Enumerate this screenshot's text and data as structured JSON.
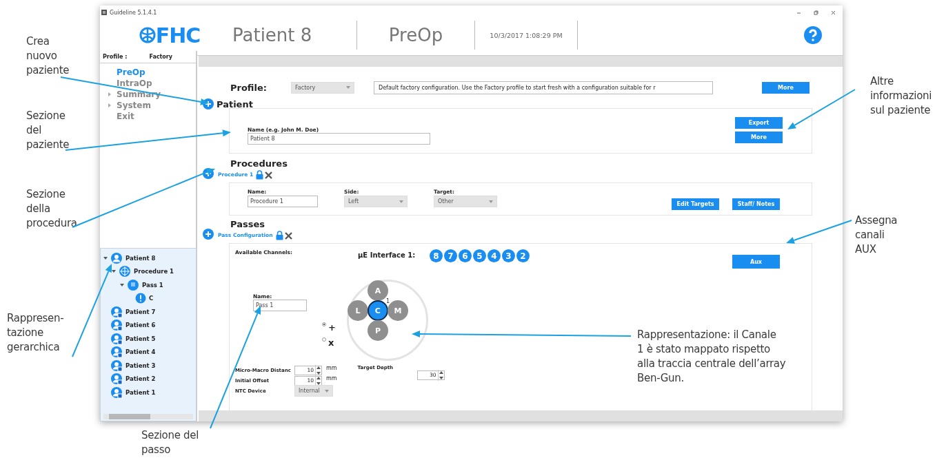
{
  "window": {
    "title": "Guideline 5.1.4.1"
  },
  "header": {
    "logo": "FHC",
    "patient": "Patient 8",
    "phase": "PreOp",
    "datetime": "10/3/2017 1:08:29 PM"
  },
  "sidebar": {
    "profile_label": "Profile :",
    "profile_value": "Factory",
    "nav": [
      {
        "label": "PreOp",
        "selected": true,
        "expandable": false
      },
      {
        "label": "IntraOp",
        "selected": false,
        "expandable": false
      },
      {
        "label": "Summary",
        "selected": false,
        "expandable": true
      },
      {
        "label": "System",
        "selected": false,
        "expandable": true
      },
      {
        "label": "Exit",
        "selected": false,
        "expandable": false
      }
    ],
    "tree": [
      {
        "label": "Patient 8",
        "kind": "patient",
        "locked": false,
        "expanded": true,
        "children": [
          {
            "label": "Procedure 1",
            "kind": "procedure",
            "expanded": true,
            "children": [
              {
                "label": "Pass 1",
                "kind": "pass",
                "expanded": true,
                "children": [
                  {
                    "label": "C",
                    "kind": "channel"
                  }
                ]
              }
            ]
          }
        ]
      },
      {
        "label": "Patient 7",
        "kind": "patient",
        "locked": true
      },
      {
        "label": "Patient 6",
        "kind": "patient",
        "locked": true
      },
      {
        "label": "Patient 5",
        "kind": "patient",
        "locked": true
      },
      {
        "label": "Patient 4",
        "kind": "patient",
        "locked": true
      },
      {
        "label": "Patient 3",
        "kind": "patient",
        "locked": true
      },
      {
        "label": "Patient 2",
        "kind": "patient",
        "locked": true
      },
      {
        "label": "Patient 1",
        "kind": "patient",
        "locked": true
      }
    ]
  },
  "profile": {
    "label": "Profile:",
    "value": "Factory",
    "description": "Default factory configuration. Use the Factory profile to start fresh with a configuration suitable for r",
    "button": "More"
  },
  "patient": {
    "heading": "Patient",
    "name_label": "Name (e.g. John M. Doe)",
    "name_value": "Patient 8",
    "buttons": [
      "Export",
      "More"
    ]
  },
  "procedures": {
    "heading": "Procedures",
    "tabs": [
      {
        "label": "Procedure 1",
        "selected": true
      }
    ],
    "fields": [
      {
        "label": "Name:",
        "value": "Procedure 1",
        "kind": "text"
      },
      {
        "label": "Side:",
        "value": "Left",
        "kind": "select"
      },
      {
        "label": "Target:",
        "value": "Other",
        "kind": "select"
      }
    ],
    "buttons": [
      "Edit Targets",
      "Staff/ Notes"
    ]
  },
  "passes": {
    "heading": "Passes",
    "tabs": [
      {
        "label": "Pass Configuration",
        "selected": true
      }
    ],
    "channels_label": "Available Channels:",
    "interface_label": "µE Interface 1:",
    "channels": [
      "8",
      "7",
      "6",
      "5",
      "4",
      "3",
      "2"
    ],
    "aux_button": "Aux",
    "name_label": "Name:",
    "name_value": "Pass 1",
    "configs": [
      {
        "label": "+",
        "selected": true
      },
      {
        "label": "x",
        "selected": false
      }
    ],
    "ben_gun": [
      {
        "label": "A",
        "assigned": false
      },
      {
        "label": "L",
        "assigned": false
      },
      {
        "label": "C",
        "assigned": true,
        "channel": "1"
      },
      {
        "label": "M",
        "assigned": false
      },
      {
        "label": "P",
        "assigned": false
      }
    ],
    "settings": [
      {
        "label": "Micro-Macro Distanc",
        "value": "10",
        "unit": "mm",
        "kind": "spin"
      },
      {
        "label": "Initial Offset",
        "value": "10",
        "unit": "mm",
        "kind": "spin"
      },
      {
        "label": "NTC Device",
        "value": "Internal",
        "kind": "select"
      }
    ],
    "target_depth": {
      "label": "Target Depth",
      "value": "30",
      "kind": "spin"
    }
  },
  "annotations": [
    {
      "text": "Crea\nnuovo\npaziente"
    },
    {
      "text": "Sezione\ndel\npaziente"
    },
    {
      "text": "Sezione\ndella\nprocedura"
    },
    {
      "text": "Rappresen-\ntazione\ngerarchica"
    },
    {
      "text": "Sezione del\npasso"
    },
    {
      "text": "Altre\ninformazioni\nsul paziente"
    },
    {
      "text": "Assegna\ncanali\nAUX"
    },
    {
      "text": "Rappresentazione: il Canale\n1 è stato mappato rispetto\nalla traccia centrale dell’array\nBen-Gun."
    }
  ]
}
